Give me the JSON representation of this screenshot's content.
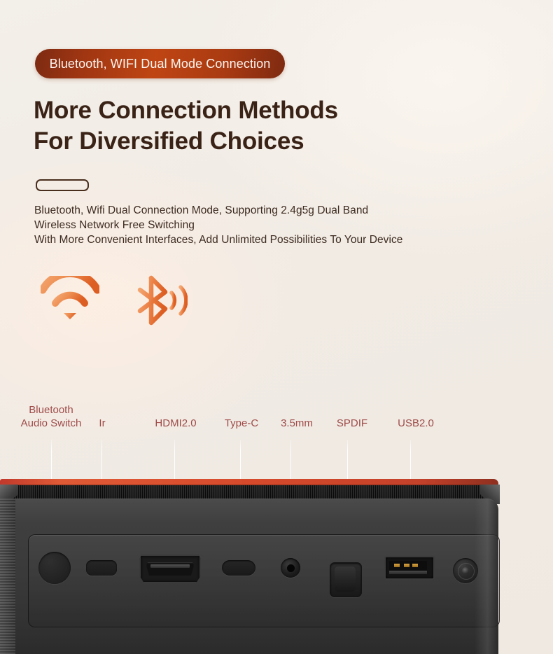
{
  "badge": {
    "label": "Bluetooth, WIFI Dual Mode Connection",
    "color": "#b8431a"
  },
  "headline": {
    "line1": "More Connection Methods",
    "line2": "For Diversified Choices",
    "color": "#3a2316"
  },
  "body": {
    "line1": "Bluetooth, Wifi Dual Connection Mode, Supporting 2.4g5g Dual Band",
    "line2": "Wireless Network Free Switching",
    "line3": "With More Convenient Interfaces, Add Unlimited Possibilities To Your Device"
  },
  "wireless_icons": [
    {
      "name": "wifi-icon",
      "label": "WiFi"
    },
    {
      "name": "bluetooth-icon",
      "label": "Bluetooth"
    }
  ],
  "accent_colors": {
    "icon_gradient_start": "#f09a5e",
    "icon_gradient_end": "#de5f24",
    "label_text": "#9e4b49",
    "device_accent": "#d64a2b",
    "background": "#f1ece6"
  },
  "ports": [
    {
      "name": "bluetooth-audio-switch",
      "label_line1": "Bluetooth",
      "label_line2": "Audio Switch",
      "label": "Bluetooth Audio Switch"
    },
    {
      "name": "ir",
      "label_line1": "Ir",
      "label_line2": "",
      "label": "Ir"
    },
    {
      "name": "hdmi",
      "label_line1": "HDMI2.0",
      "label_line2": "",
      "label": "HDMI2.0"
    },
    {
      "name": "type-c",
      "label_line1": "Type-C",
      "label_line2": "",
      "label": "Type-C"
    },
    {
      "name": "audio-jack",
      "label_line1": "3.5mm",
      "label_line2": "",
      "label": "3.5mm"
    },
    {
      "name": "spdif",
      "label_line1": "SPDIF",
      "label_line2": "",
      "label": "SPDIF"
    },
    {
      "name": "usb",
      "label_line1": "USB2.0",
      "label_line2": "",
      "label": "USB2.0"
    }
  ]
}
